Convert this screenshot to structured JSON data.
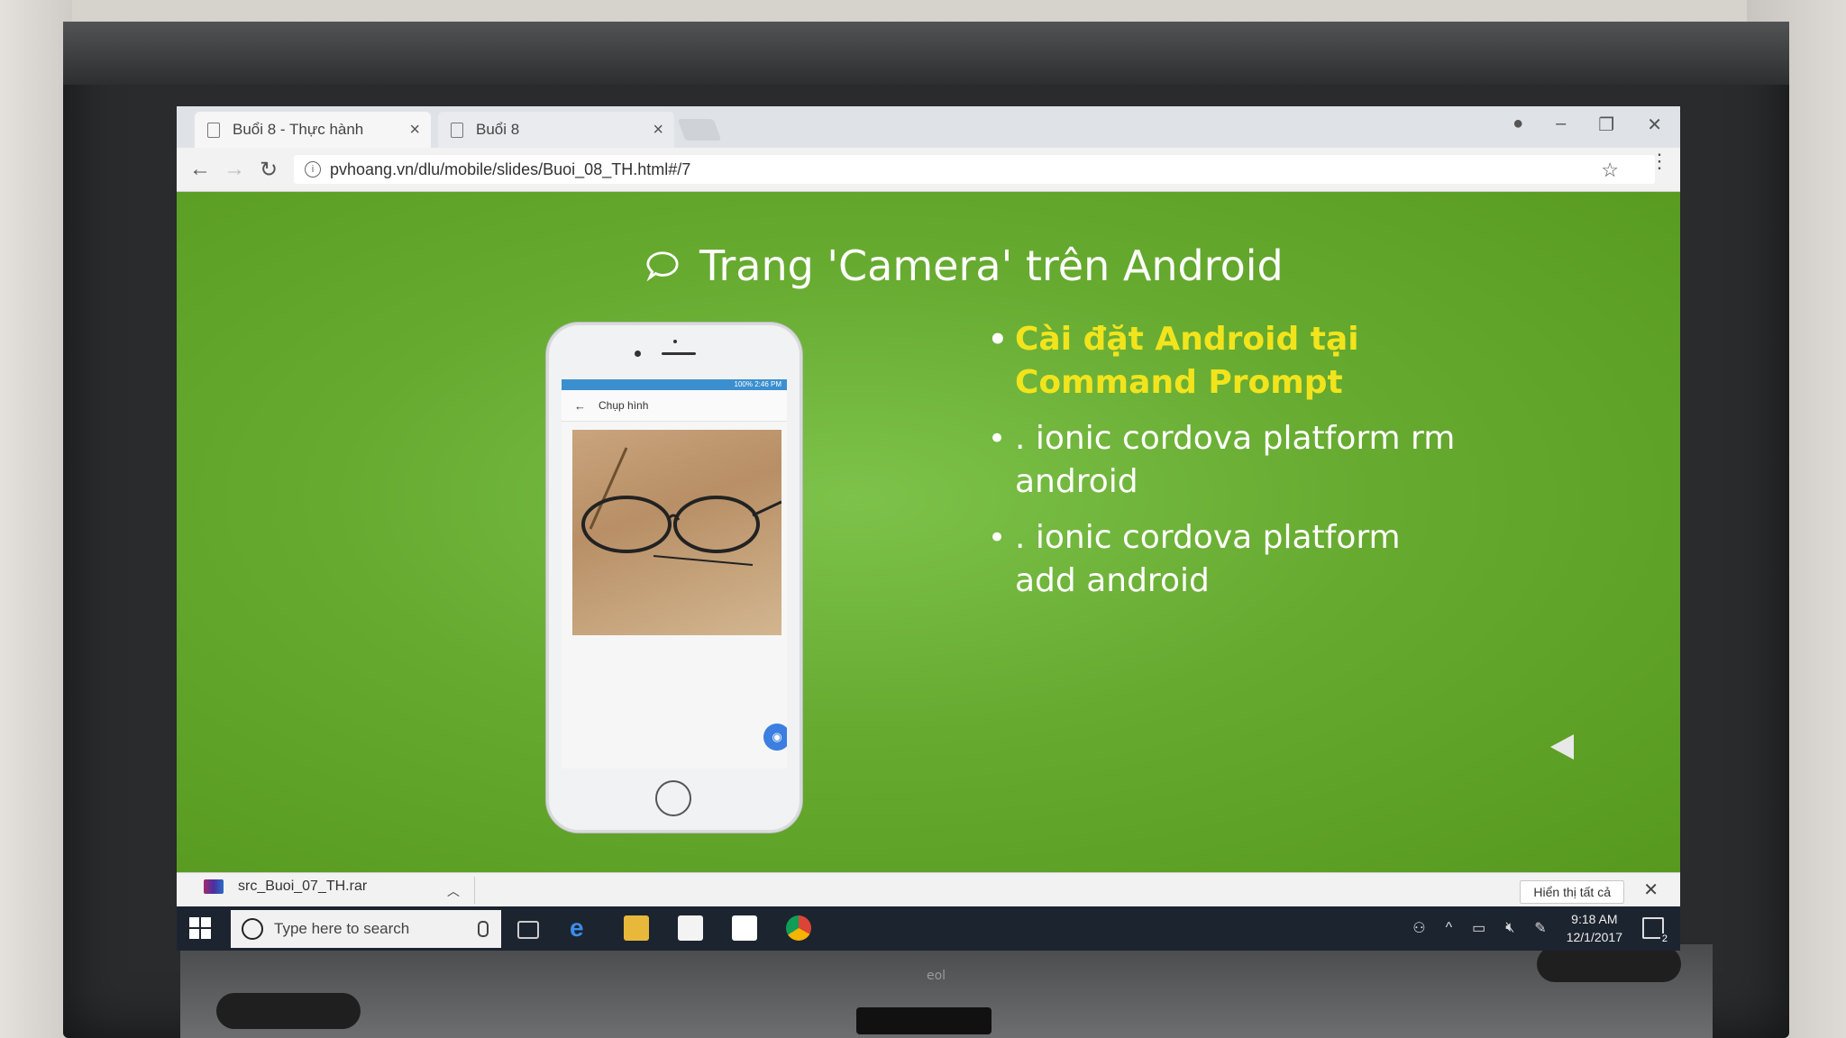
{
  "browser": {
    "tabs": [
      {
        "label": "Buổi 8 - Thực hành"
      },
      {
        "label": "Buổi 8"
      }
    ],
    "url": "pvhoang.vn/dlu/mobile/slides/Buoi_08_TH.html#/7"
  },
  "slide": {
    "title": "Trang 'Camera' trên Android",
    "bullets": [
      "Cài đặt Android tại Command Prompt",
      ". ionic cordova platform rm android",
      ". ionic cordova platform add android"
    ],
    "highlight_color": "#f2e41c",
    "background_color": "#66aa30"
  },
  "phone": {
    "app_title": "Chụp hình",
    "status_text": "100% 2:46 PM"
  },
  "download_bar": {
    "file_name": "src_Buoi_07_TH.rar",
    "show_all_label": "Hiển thị tất cả"
  },
  "taskbar": {
    "search_placeholder": "Type here to search",
    "time": "9:18 AM",
    "date": "12/1/2017",
    "notification_count": "2"
  },
  "tv": {
    "brand": "eol"
  }
}
